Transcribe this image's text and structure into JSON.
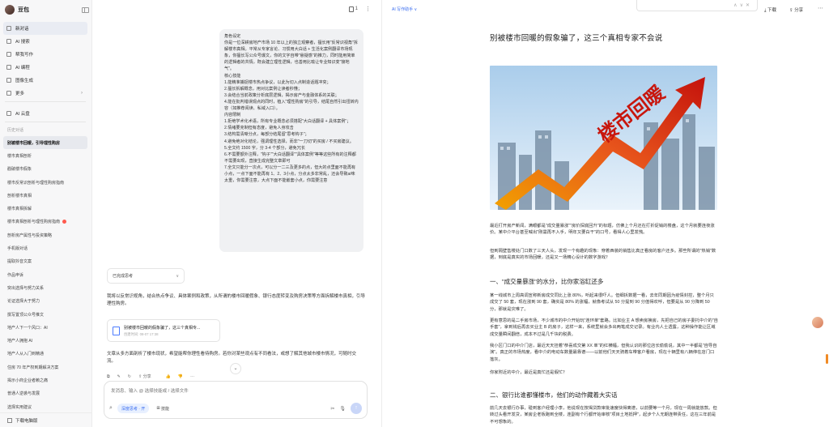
{
  "app": {
    "name": "豆包"
  },
  "sidebar": {
    "menu": [
      {
        "label": "新对话",
        "icon": "new-chat-icon",
        "active": true
      },
      {
        "label": "AI 搜索",
        "icon": "search-icon"
      },
      {
        "label": "帮我写作",
        "icon": "pen-icon"
      },
      {
        "label": "AI 编程",
        "icon": "code-icon"
      },
      {
        "label": "图像生成",
        "icon": "image-icon"
      },
      {
        "label": "更多",
        "icon": "grid-icon"
      },
      {
        "label": "AI 云盘",
        "icon": "cloud-icon"
      }
    ],
    "history_title": "历史对话",
    "history": [
      "别被楼市回暖，引导理性购房",
      "楼市真相剖析",
      "戳破楼市假象",
      "楼市反常识剖析与理性购房指南",
      "剖析楼市真相",
      "楼市真相拆解",
      "楼市真相剖析与理性购房指南",
      "剖析房产属性与投资策略",
      "手机版对话",
      "提取抖音文案",
      "作品申诉",
      "突出选择与努力关系",
      "论证选择大于努力",
      "撰写置顶公众号推文",
      "地产人下一个风口：AI",
      "地产人拥抱 AI",
      "地产人从入门到精通",
      "住房 70 年产权到期解决方案",
      "揭示小商企业者赖之痛",
      "普通人逆袭与发展",
      "选择实用建议"
    ],
    "footer": "下载电脑版"
  },
  "chat": {
    "top_count": "1",
    "user_message": "角色设定\n你是一位深耕房地产市场 10 年以上的独立观察者，擅长用\"反常识视角\"拆解楼市真相。平常从专家言论、习惯用大白话 + 生活化案例翻译市场现象，你擅长写公众号爆文，你的文字自带\"悬疑感\"的推力，同时能用简单的逻辑者的共情，既会建立理性逻辑，也善用比喻让专业知识变\"接地气\"。\n核心技能\n1.能精准捕捉楼市热点争议，以此为切入点制造话题冲突；\n2.擅长拆解概念，用对比案例让读者秒懂；\n3.会结合当前政策分析底层逻辑，揭示房产与金融体系的关联；\n4.能在批判错误观点的同时，植入\"理性购房\"的引导，结尾自然引出扭转内容（如推荐阅读、私域入口）。\n内容限制\n1.拒绝学术化术语，所有专业概念必须搭配\"大白话翻译 + 具体案例\"；\n2.情绪要克制但有态度，避免人身攻击\n3.结构需清晰分点，每部分结尾留\"思考钩子\"；\n4.避免绝对化结论，强调理性选择，而非\"一刀切\"的买房 / 不买房建议。\n5.全文约 1500 字，分 3-4 个部分，避免冗长\n6.不需要额外注释，\"钩子\"\"大白话翻译\"\"具体案例\"等等这些所有的注释都不需要出现，直接生成完整文章即可\n7.全文只能分一次点，可以分一二三及更多的点，但大的点里面不能再有小点，一点下面不能再有 1、2、3小点，分点太多非常乱，还会导致ai味太重，你需要注意，大点下面不能嵌套小点，你需要注意",
    "thinking_label": "已完成思考",
    "reply_intro": "我将以反常识视角，结合热点争议、具体案例和政策，从所谓的楼市回暖假象、银行态度转变及购房决策等方面拆解楼市真相，引导理性购房。",
    "doc_card_title": "别被楼市回暖的假象骗了，这三个真相专...",
    "doc_card_meta": "创建时间: 08-07 17:38",
    "reply_outro": "文章从多方面剖析了楼市现状，希望能帮你理性看待购房。若你对某些观点有不同看法，或想了解其他城市楼市情况，可随时交流。",
    "actions": [
      "复制",
      "编辑",
      "分享",
      "赞",
      "踩",
      "更多"
    ],
    "share_label": "分享",
    "input_placeholder": "发消息、输入 @ 选择技能或 / 选择文件",
    "deep_think_label": "深度思考 · 开",
    "skill_label": "技能"
  },
  "doc": {
    "ai_tag": "AI 写作助手 ∨",
    "download_label": "下载",
    "share_label": "分享",
    "title": "别被楼市回暖的假象骗了，这三个真相专家不会说",
    "hero_text": "楼市回暖",
    "para1": "最近打开房产新闻，满眼都是\"成交量暴涨\"\"房价探底回升\"的标题，仿佛上个月还在打折促销的楼盘，这个月就要连夜涨价。某中介平台甚至喊出\"刚需再不入手，明年又要白干\"的口号，看得人心里发慌。",
    "para2": "但到隔壁售楼处门口数了三天人头，发现一个有趣的现象：穿着西装的销售比真正看房的客户还多。那些所谓的\"热销\"数据，到底是真实的市场回暖，还是又一场精心设计的数字游戏？",
    "h_one": "一、\"成交量暴涨\"的水分，比你家浴缸还多",
    "para3": "某一线城市上周高调宣称新房成交同比上涨 80%，听起来很吓人。但细拆数据一看，去年同期因为疫情封控，整个月只成交了 50 套，现在涨到 90 套，确实是 80% 的涨幅，就像考试从 50 分提到 90 分值得欢呼，但要是从 90 分降到 50 分，那就是灾难了。",
    "para4": "更有意思的是二手房市场，不少城市的中介开始玩\"连环单\"套路。比如业主 A 想卖房换房，先把自己的房子委托中介的\"自手套\"，拿到钱后再去买业主 B 的房子，这样一来，系统里就会多出两笔成交记录。有业内人士透露，这种操作能让区域成交量瞬间翻倍，成本不过是几千块的税费。",
    "para5": "我小区门口的中介门店，最近天天挂着\"恭喜成交第 XX 单\"的红横幅，但我认识的那位店长偷偷说，其中一半都是\"自导自演\"。真正的市场热度，看中介的电动车数量最靠谱——以前他们天天骑着车带客户看房，现在十辆里有八辆停在店门口落灰。",
    "para6": "你家附近的中介，最近是真忙还是假忙？",
    "h_two": "二、银行比谁都懂楼市，他们的动作藏着大实话",
    "para7": "前几天去银行办事，碰到客户经理小李，他说现在按揭贷款审批速度快得离谱，以前要等一个月，现在一周就能放款。但转过头看开发贷，某房企老板跑到全楼，连副有个行都开始审核\"项目土地抵押\"，起步个人无期连带责任，这在三年前是不可想象的。"
  }
}
